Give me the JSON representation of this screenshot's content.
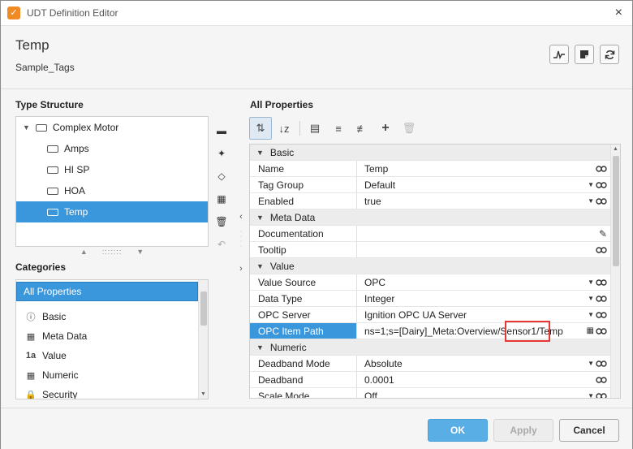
{
  "window": {
    "title": "UDT Definition Editor",
    "close_icon": "×"
  },
  "header": {
    "tag_name": "Temp",
    "tag_provider": "Sample_Tags"
  },
  "type_structure": {
    "label": "Type Structure",
    "root": "Complex Motor",
    "items": [
      "Amps",
      "HI SP",
      "HOA",
      "Temp"
    ],
    "selected": "Temp"
  },
  "categories": {
    "label": "Categories",
    "items": [
      {
        "label": "All Properties",
        "icon": ""
      },
      {
        "label": "Basic",
        "icon": "info-icon"
      },
      {
        "label": "Meta Data",
        "icon": "meta-icon"
      },
      {
        "label": "Value",
        "icon": "value-icon"
      },
      {
        "label": "Numeric",
        "icon": "numeric-icon"
      },
      {
        "label": "Security",
        "icon": "security-icon"
      }
    ]
  },
  "props": {
    "label": "All Properties",
    "rows": [
      {
        "type": "cat",
        "name": "Basic"
      },
      {
        "name": "Name",
        "value": "Temp"
      },
      {
        "name": "Tag Group",
        "value": "Default"
      },
      {
        "name": "Enabled",
        "value": "true"
      },
      {
        "type": "cat",
        "name": "Meta Data"
      },
      {
        "name": "Documentation",
        "value": ""
      },
      {
        "name": "Tooltip",
        "value": ""
      },
      {
        "type": "cat",
        "name": "Value"
      },
      {
        "name": "Value Source",
        "value": "OPC"
      },
      {
        "name": "Data Type",
        "value": "Integer"
      },
      {
        "name": "OPC Server",
        "value": "Ignition OPC UA Server"
      },
      {
        "name": "OPC Item Path",
        "value": "ns=1;s=[Dairy]_Meta:Overview/Sensor1/Temp"
      },
      {
        "type": "cat",
        "name": "Numeric"
      },
      {
        "name": "Deadband Mode",
        "value": "Absolute"
      },
      {
        "name": "Deadband",
        "value": "0.0001"
      },
      {
        "name": "Scale Mode",
        "value": "Off"
      }
    ]
  },
  "footer": {
    "ok": "OK",
    "apply": "Apply",
    "cancel": "Cancel"
  }
}
